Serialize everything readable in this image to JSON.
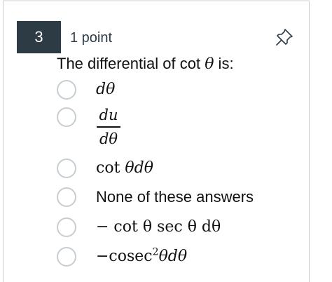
{
  "question": {
    "number": "3",
    "points": "1 point",
    "prompt_prefix": "The differential of ",
    "prompt_func": "cot",
    "prompt_var": "θ",
    "prompt_suffix": " is:"
  },
  "options": {
    "a": {
      "text": "dθ"
    },
    "b": {
      "numerator": "du",
      "denominator": "dθ"
    },
    "c": {
      "fn": "cot",
      "var": "θdθ"
    },
    "d": {
      "text": "None of these answers"
    },
    "e": {
      "text": "− cot θ sec θ dθ"
    },
    "f": {
      "prefix": "−cosec",
      "exponent": "2",
      "suffix": "θdθ"
    }
  },
  "icons": {
    "pin": "pin-icon"
  },
  "colors": {
    "badge_bg": "#2d3b45",
    "radio_border": "#c7cdd1",
    "text": "#111111"
  }
}
